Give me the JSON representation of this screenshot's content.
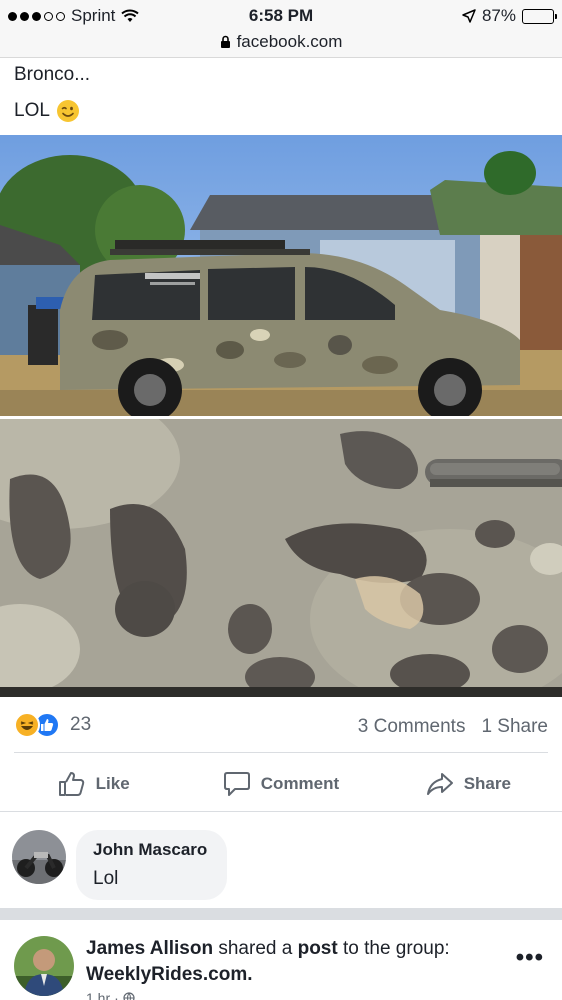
{
  "status": {
    "carrier": "Sprint",
    "time": "6:58 PM",
    "battery": "87%",
    "battery_level": 0.87,
    "url": "facebook.com"
  },
  "post": {
    "text_line1": "Bronco...",
    "text_line2": "LOL",
    "reactions": {
      "count": "23",
      "types": [
        "haha",
        "like"
      ]
    },
    "comments_count": "3 Comments",
    "shares_count": "1 Share"
  },
  "actions": {
    "like": "Like",
    "comment": "Comment",
    "share": "Share"
  },
  "comment": {
    "author": "John Mascaro",
    "text": "Lol"
  },
  "next_post": {
    "author": "James Allison",
    "verb1": "shared a",
    "object": "post",
    "verb2": "to the group:",
    "group": "WeeklyRides.com.",
    "time": "1 hr",
    "more": "•••"
  },
  "colors": {
    "facebook_blue": "#2078f4",
    "haha_yellow": "#f7b125",
    "secondary_text": "#606770"
  }
}
